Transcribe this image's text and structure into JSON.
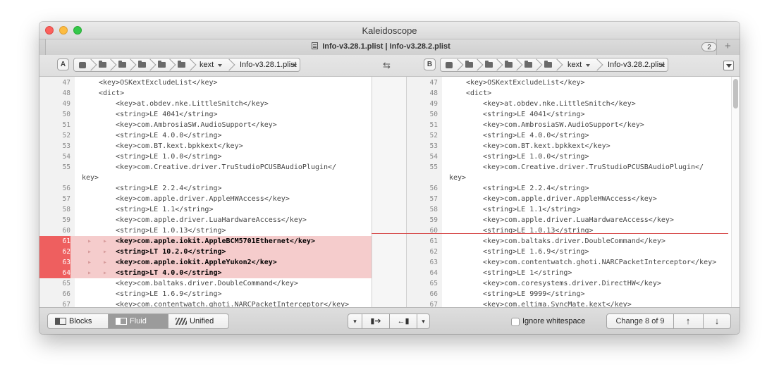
{
  "window": {
    "title": "Kaleidoscope"
  },
  "tab": {
    "title": "Info-v3.28.1.plist | Info-v3.28.2.plist",
    "count": "2",
    "add_label": "+"
  },
  "left": {
    "side_label": "A",
    "crumb_folder": "kext",
    "crumb_file": "Info-v3.28.1.plist",
    "lines": [
      {
        "n": "47",
        "t": "<key>OSKextExcludeList</key>",
        "i": 1
      },
      {
        "n": "48",
        "t": "<dict>",
        "i": 1
      },
      {
        "n": "49",
        "t": "<key>at.obdev.nke.LittleSnitch</key>",
        "i": 2
      },
      {
        "n": "50",
        "t": "<string>LE 4041</string>",
        "i": 2
      },
      {
        "n": "51",
        "t": "<key>com.AmbrosiaSW.AudioSupport</key>",
        "i": 2
      },
      {
        "n": "52",
        "t": "<string>LE 4.0.0</string>",
        "i": 2
      },
      {
        "n": "53",
        "t": "<key>com.BT.kext.bpkkext</key>",
        "i": 2
      },
      {
        "n": "54",
        "t": "<string>LE 1.0.0</string>",
        "i": 2
      },
      {
        "n": "55",
        "t": "<key>com.Creative.driver.TruStudioPCUSBAudioPlugin</",
        "i": 2
      },
      {
        "n": "",
        "t": "key>",
        "i": 0
      },
      {
        "n": "56",
        "t": "<string>LE 2.2.4</string>",
        "i": 2
      },
      {
        "n": "57",
        "t": "<key>com.apple.driver.AppleHWAccess</key>",
        "i": 2
      },
      {
        "n": "58",
        "t": "<string>LE 1.1</string>",
        "i": 2
      },
      {
        "n": "59",
        "t": "<key>com.apple.driver.LuaHardwareAccess</key>",
        "i": 2
      },
      {
        "n": "60",
        "t": "<string>LE 1.0.13</string>",
        "i": 2
      },
      {
        "n": "61",
        "t": "<key>com.apple.iokit.AppleBCM5701Ethernet</key>",
        "i": 2,
        "c": true
      },
      {
        "n": "62",
        "t": "<string>LT 10.2.0</string>",
        "i": 2,
        "c": true
      },
      {
        "n": "63",
        "t": "<key>com.apple.iokit.AppleYukon2</key>",
        "i": 2,
        "c": true
      },
      {
        "n": "64",
        "t": "<string>LT 4.0.0</string>",
        "i": 2,
        "c": true
      },
      {
        "n": "65",
        "t": "<key>com.baltaks.driver.DoubleCommand</key>",
        "i": 2
      },
      {
        "n": "66",
        "t": "<string>LE 1.6.9</string>",
        "i": 2
      },
      {
        "n": "67",
        "t": "<key>com.contentwatch.ghoti.NARCPacketInterceptor</key>",
        "i": 2
      }
    ]
  },
  "right": {
    "side_label": "B",
    "crumb_folder": "kext",
    "crumb_file": "Info-v3.28.2.plist",
    "lines": [
      {
        "n": "47",
        "t": "<key>OSKextExcludeList</key>",
        "i": 1
      },
      {
        "n": "48",
        "t": "<dict>",
        "i": 1
      },
      {
        "n": "49",
        "t": "<key>at.obdev.nke.LittleSnitch</key>",
        "i": 2
      },
      {
        "n": "50",
        "t": "<string>LE 4041</string>",
        "i": 2
      },
      {
        "n": "51",
        "t": "<key>com.AmbrosiaSW.AudioSupport</key>",
        "i": 2
      },
      {
        "n": "52",
        "t": "<string>LE 4.0.0</string>",
        "i": 2
      },
      {
        "n": "53",
        "t": "<key>com.BT.kext.bpkkext</key>",
        "i": 2
      },
      {
        "n": "54",
        "t": "<string>LE 1.0.0</string>",
        "i": 2
      },
      {
        "n": "55",
        "t": "<key>com.Creative.driver.TruStudioPCUSBAudioPlugin</",
        "i": 2
      },
      {
        "n": "",
        "t": "key>",
        "i": 0
      },
      {
        "n": "56",
        "t": "<string>LE 2.2.4</string>",
        "i": 2
      },
      {
        "n": "57",
        "t": "<key>com.apple.driver.AppleHWAccess</key>",
        "i": 2
      },
      {
        "n": "58",
        "t": "<string>LE 1.1</string>",
        "i": 2
      },
      {
        "n": "59",
        "t": "<key>com.apple.driver.LuaHardwareAccess</key>",
        "i": 2
      },
      {
        "n": "60",
        "t": "<string>LE 1.0.13</string>",
        "i": 2
      },
      {
        "n": "61",
        "t": "<key>com.baltaks.driver.DoubleCommand</key>",
        "i": 2
      },
      {
        "n": "62",
        "t": "<string>LE 1.6.9</string>",
        "i": 2
      },
      {
        "n": "63",
        "t": "<key>com.contentwatch.ghoti.NARCPacketInterceptor</key>",
        "i": 2
      },
      {
        "n": "64",
        "t": "<string>LE 1</string>",
        "i": 2
      },
      {
        "n": "65",
        "t": "<key>com.coresystems.driver.DirectHW</key>",
        "i": 2
      },
      {
        "n": "66",
        "t": "<string>LE 9999</string>",
        "i": 2
      },
      {
        "n": "67",
        "t": "<key>com.eltima.SyncMate.kext</key>",
        "i": 2
      }
    ]
  },
  "bottom": {
    "modes": [
      "Blocks",
      "Fluid",
      "Unified"
    ],
    "active_mode": "Fluid",
    "ignore_whitespace_label": "Ignore whitespace",
    "ignore_whitespace_checked": false,
    "change_label": "Change 8 of 9"
  },
  "colors": {
    "changed_bg": "#f5cccc",
    "changed_gutter": "#ee5f5f",
    "change_line": "#d64a4a"
  }
}
